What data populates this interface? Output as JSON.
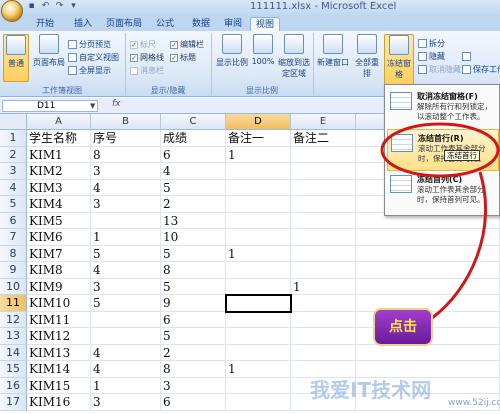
{
  "window": {
    "title": "111111.xlsx - Microsoft Excel"
  },
  "tabs": [
    "开始",
    "插入",
    "页面布局",
    "公式",
    "数据",
    "审阅",
    "视图"
  ],
  "ribbon": {
    "workbook_views": {
      "label": "工作簿视图",
      "normal": "普通",
      "page_layout": "页面布局",
      "page_break": "分页预览",
      "custom_views": "自定义视图",
      "full_screen": "全屏显示"
    },
    "show_hide": {
      "label": "显示/隐藏",
      "ruler": "标尺",
      "gridlines": "网格线",
      "message_bar": "消息栏",
      "formula_bar": "编辑栏",
      "headings": "标题"
    },
    "zoom": {
      "label": "显示比例",
      "zoom": "显示比例",
      "hundred": "100%",
      "zoom_selection": "缩放到选定区域"
    },
    "window": {
      "new_window": "新建窗口",
      "arrange_all": "全部重排",
      "freeze_panes": "冻结窗格",
      "split": "拆分",
      "hide": "隐藏",
      "unhide": "取消隐藏",
      "save_workspace": "保存工作区"
    }
  },
  "formula_bar": {
    "name_box": "D11",
    "fx": "fx"
  },
  "grid": {
    "columns": [
      "A",
      "B",
      "C",
      "D",
      "E"
    ],
    "rows": [
      {
        "n": "1",
        "cells": [
          "学生名称",
          "序号",
          "成绩",
          "备注一",
          "备注二"
        ]
      },
      {
        "n": "2",
        "cells": [
          "KIM1",
          "8",
          "6",
          "1",
          ""
        ]
      },
      {
        "n": "3",
        "cells": [
          "KIM2",
          "3",
          "4",
          "",
          ""
        ]
      },
      {
        "n": "4",
        "cells": [
          "KIM3",
          "4",
          "5",
          "",
          ""
        ]
      },
      {
        "n": "5",
        "cells": [
          "KIM4",
          "3",
          "2",
          "",
          ""
        ]
      },
      {
        "n": "6",
        "cells": [
          "KIM5",
          "",
          "13",
          "",
          ""
        ]
      },
      {
        "n": "7",
        "cells": [
          "KIM6",
          "1",
          "10",
          "",
          ""
        ]
      },
      {
        "n": "8",
        "cells": [
          "KIM7",
          "5",
          "5",
          "1",
          ""
        ]
      },
      {
        "n": "9",
        "cells": [
          "KIM8",
          "4",
          "8",
          "",
          ""
        ]
      },
      {
        "n": "10",
        "cells": [
          "KIM9",
          "3",
          "5",
          "",
          "1"
        ]
      },
      {
        "n": "11",
        "cells": [
          "KIM10",
          "5",
          "9",
          "",
          ""
        ]
      },
      {
        "n": "12",
        "cells": [
          "KIM11",
          "",
          "6",
          "",
          ""
        ]
      },
      {
        "n": "13",
        "cells": [
          "KIM12",
          "",
          "5",
          "",
          ""
        ]
      },
      {
        "n": "14",
        "cells": [
          "KIM13",
          "4",
          "2",
          "",
          ""
        ]
      },
      {
        "n": "15",
        "cells": [
          "KIM14",
          "4",
          "8",
          "1",
          ""
        ]
      },
      {
        "n": "16",
        "cells": [
          "KIM15",
          "1",
          "3",
          "",
          ""
        ]
      },
      {
        "n": "17",
        "cells": [
          "KIM16",
          "3",
          "6",
          "",
          ""
        ]
      }
    ]
  },
  "freeze_menu": {
    "items": [
      {
        "title": "取消冻结窗格(F)",
        "desc": "解除所有行和列锁定，以滚动整个工作表。"
      },
      {
        "title": "冻结首行(R)",
        "desc": "滚动工作表其余部分时，保持首行可见。"
      },
      {
        "title": "冻结首列(C)",
        "desc": "滚动工作表其余部分时，保持首列可见。"
      }
    ],
    "tooltip": "冻结首行"
  },
  "annotation": {
    "text": "点击"
  },
  "watermark": {
    "text": "我爱IT技术网",
    "url": "www.52ij.com"
  },
  "colors": {
    "accent": "#f1c15f",
    "callout": "#7a2aa8",
    "ring": "#d01818"
  }
}
